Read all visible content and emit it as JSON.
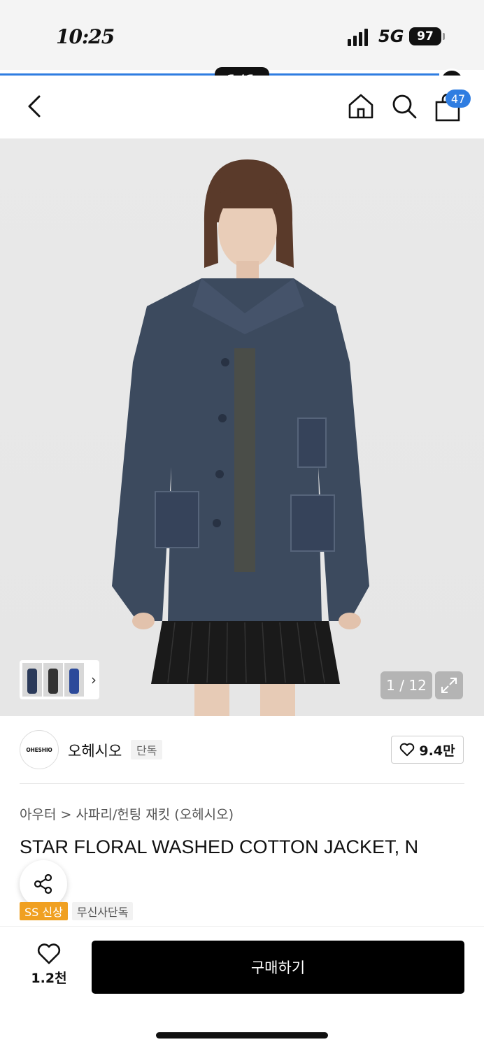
{
  "status_bar": {
    "time": "10:25",
    "network": "5G",
    "battery": "97"
  },
  "viewer": {
    "page_indicator": "1/1"
  },
  "nav": {
    "cart_count": "47"
  },
  "gallery": {
    "counter": "1 / 12",
    "thumbnail_count": 3
  },
  "brand": {
    "logo_text": "OHESHIO",
    "name": "오헤시오",
    "badge": "단독",
    "likes": "9.4만"
  },
  "product": {
    "breadcrumb": "아우터 > 사파리/헌팅 재킷 (오헤시오)",
    "title": "STAR FLORAL WASHED COTTON JACKET, N",
    "tags": [
      "SS 신상",
      "무신사단독"
    ]
  },
  "bottom_bar": {
    "like_count": "1.2천",
    "buy_label": "구매하기"
  },
  "colors": {
    "accent_blue": "#2f7de1",
    "tag_orange": "#f0a021",
    "buy_black": "#000000"
  }
}
